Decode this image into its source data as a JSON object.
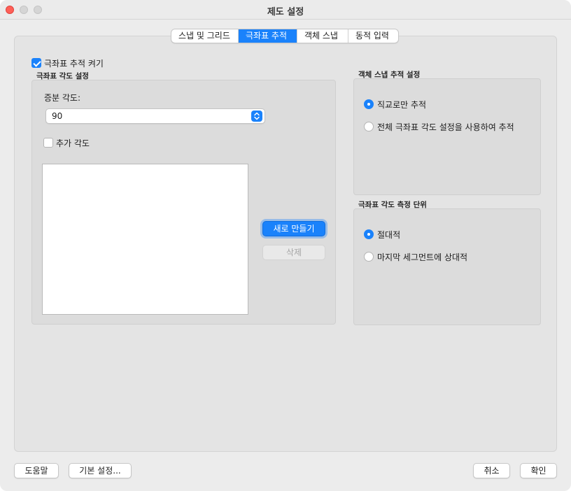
{
  "window": {
    "title": "제도 설정"
  },
  "tabs": [
    {
      "label": "스냅 및 그리드"
    },
    {
      "label": "극좌표 추적"
    },
    {
      "label": "객체 스냅"
    },
    {
      "label": "동적 입력"
    }
  ],
  "active_tab_index": 1,
  "polar": {
    "enable_label": "극좌표 추적 켜기",
    "enable_checked": true,
    "angle_settings_title": "극좌표 각도 설정",
    "increment_label": "증분 각도:",
    "increment_value": "90",
    "additional_label": "추가 각도",
    "additional_checked": false,
    "new_button": "새로 만들기",
    "delete_button": "삭제"
  },
  "object_snap_tracking": {
    "title": "객체 스냅 추적 설정",
    "options": [
      {
        "label": "직교로만 추적",
        "selected": true
      },
      {
        "label": "전체 극좌표 각도 설정을 사용하여 추적",
        "selected": false
      }
    ]
  },
  "polar_measurement": {
    "title": "극좌표 각도 측정 단위",
    "options": [
      {
        "label": "절대적",
        "selected": true
      },
      {
        "label": "마지막 세그먼트에 상대적",
        "selected": false
      }
    ]
  },
  "footer": {
    "help": "도움말",
    "defaults": "기본 설정...",
    "cancel": "취소",
    "ok": "확인"
  },
  "colors": {
    "accent": "#1a82fb",
    "close": "#fe5f57"
  }
}
